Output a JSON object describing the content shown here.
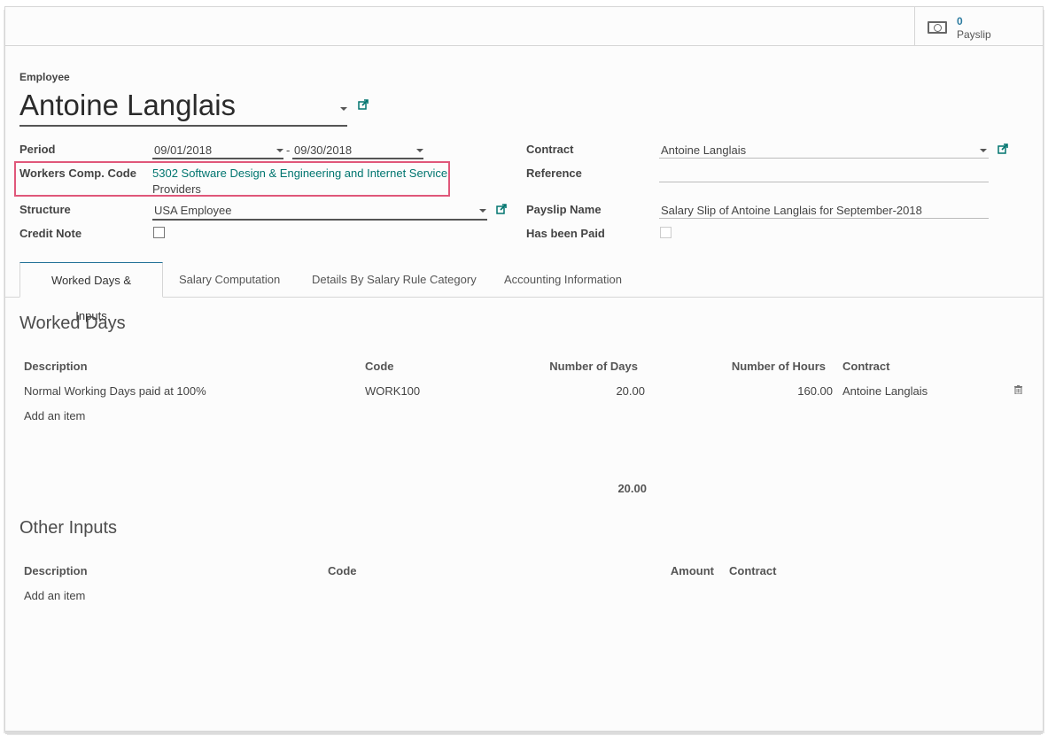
{
  "stat_button": {
    "icon": "money-icon",
    "value": "0",
    "label": "Payslip"
  },
  "employee": {
    "label": "Employee",
    "name": "Antoine Langlais"
  },
  "left_fields": {
    "period_label": "Period",
    "period_from": "09/01/2018",
    "period_sep": "-",
    "period_to": "09/30/2018",
    "workers_comp_label": "Workers Comp. Code",
    "workers_comp_line1": "5302 Software Design & Engineering and Internet Service",
    "workers_comp_line2": "Providers",
    "structure_label": "Structure",
    "structure_value": "USA Employee",
    "credit_note_label": "Credit Note",
    "credit_note_checked": false
  },
  "right_fields": {
    "contract_label": "Contract",
    "contract_value": "Antoine Langlais",
    "reference_label": "Reference",
    "reference_value": "",
    "payslip_name_label": "Payslip Name",
    "payslip_name_value": "Salary Slip of Antoine Langlais for September-2018",
    "has_been_paid_label": "Has been Paid",
    "has_been_paid_checked": false
  },
  "tabs": [
    {
      "label": "Worked Days & Inputs",
      "active": true
    },
    {
      "label": "Salary Computation",
      "active": false
    },
    {
      "label": "Details By Salary Rule Category",
      "active": false
    },
    {
      "label": "Accounting Information",
      "active": false
    }
  ],
  "worked_days": {
    "title": "Worked Days",
    "columns": [
      "Description",
      "Code",
      "Number of Days",
      "Number of Hours",
      "Contract"
    ],
    "rows": [
      {
        "description": "Normal Working Days paid at 100%",
        "code": "WORK100",
        "days": "20.00",
        "hours": "160.00",
        "contract": "Antoine Langlais"
      }
    ],
    "add_item": "Add an item",
    "total_days": "20.00"
  },
  "other_inputs": {
    "title": "Other Inputs",
    "columns": [
      "Description",
      "Code",
      "Amount",
      "Contract"
    ],
    "add_item": "Add an item"
  },
  "colors": {
    "link": "#00756f",
    "highlight": "#e0577a",
    "active_tab_top": "#1f6f96",
    "stat_value": "#2c7ba0"
  }
}
